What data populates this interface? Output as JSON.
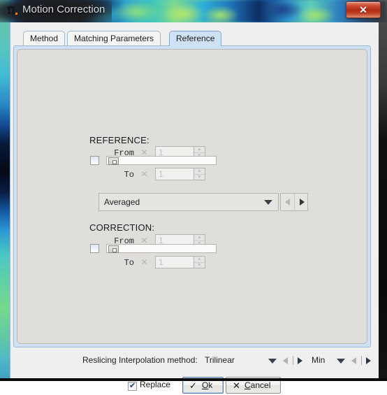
{
  "window": {
    "title": "Motion Correction",
    "icon": "app-icon",
    "close_label": "✕"
  },
  "tabs": [
    {
      "label": "Method",
      "selected": false
    },
    {
      "label": "Matching Parameters",
      "selected": false
    },
    {
      "label": "Reference",
      "selected": true
    }
  ],
  "reference": {
    "title": "REFERENCE:",
    "from_label": "From",
    "from_value": "1",
    "to_label": "To",
    "to_value": "1",
    "clear_glyph": "✕",
    "enable_checked": false,
    "mode_value": "Averaged",
    "spin_up": "▲",
    "spin_down": "▼"
  },
  "correction": {
    "title": "CORRECTION:",
    "from_label": "From",
    "from_value": "1",
    "to_label": "To",
    "to_value": "1",
    "clear_glyph": "✕",
    "enable_checked": false,
    "spin_up": "▲",
    "spin_down": "▼"
  },
  "reslicing": {
    "label": "Reslicing Interpolation method:",
    "method_value": "Trilinear",
    "edge_value": "Min"
  },
  "footer": {
    "replace_label": "Replace",
    "replace_checked": true,
    "ok_glyph": "✓",
    "ok_label_pre": "",
    "ok_label_key": "O",
    "ok_label_post": "k",
    "cancel_glyph": "✕",
    "cancel_label_pre": "",
    "cancel_label_key": "C",
    "cancel_label_post": "ancel"
  },
  "colors": {
    "tab_selected": "#cfe2f5",
    "panel": "#e0dedb",
    "client": "#efefef",
    "close_button": "#b02a15",
    "border": "#9fb6cf"
  }
}
